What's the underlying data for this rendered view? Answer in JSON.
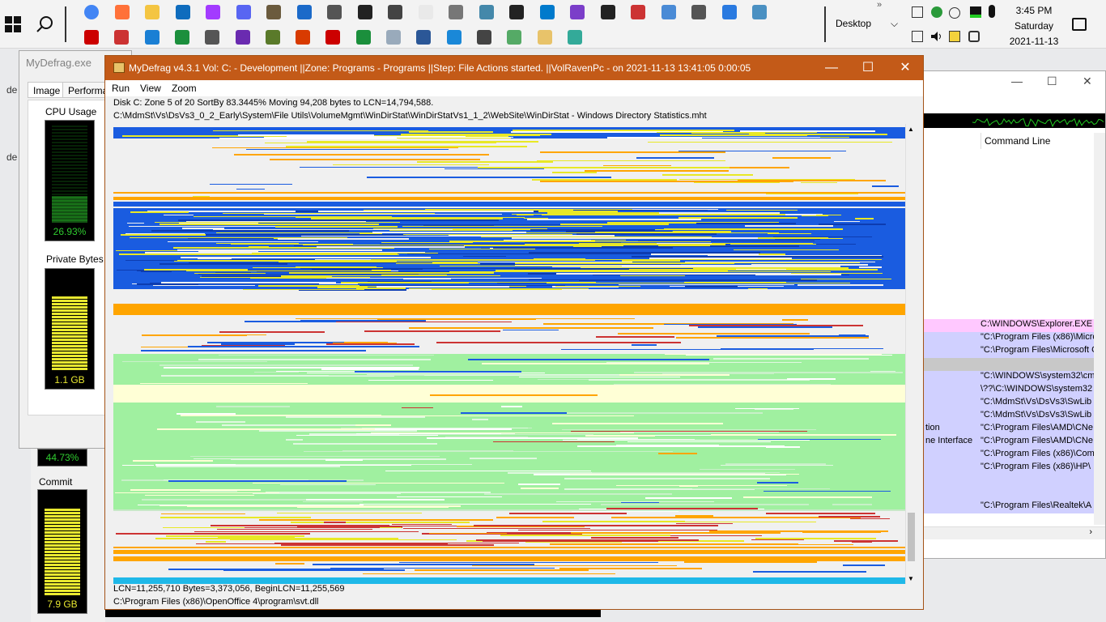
{
  "taskbar": {
    "desktop_label": "Desktop",
    "clock": {
      "time": "3:45 PM",
      "day": "Saturday",
      "date": "2021-11-13"
    },
    "pinned_icons": [
      "chrome-icon",
      "firefox-icon",
      "file-explorer-icon",
      "outlook-icon",
      "messenger-icon",
      "discord-icon",
      "gimp-icon",
      "photos-icon",
      "tool-icon",
      "cap-icon",
      "printer-icon",
      "notepad-icon",
      "checker-icon",
      "plugin-icon",
      "terminal-icon",
      "vscode-icon",
      "visual-studio-icon",
      "cmd-icon",
      "xmind-icon",
      "app-icon",
      "settings-icon",
      "remote-icon",
      "monitor-icon"
    ],
    "pinned_icons_row2": [
      "acrobat-icon",
      "pdf-icon",
      "todo-icon",
      "excel-icon",
      "screen-icon",
      "video-icon",
      "palm-icon",
      "office-icon",
      "acrobat-reader-icon",
      "spreadsheet-icon",
      "notes-icon",
      "word-icon",
      "browser-icon",
      "tool2-icon",
      "document-icon",
      "mydefrag-icon",
      "plugin2-icon"
    ]
  },
  "process_explorer": {
    "title": "MyDefrag.exe",
    "tabs": [
      "Image",
      "Performan"
    ],
    "cpu": {
      "label": "CPU Usage",
      "value": "26.93%",
      "fill": 0.27
    },
    "private_bytes": {
      "label": "Private Bytes",
      "value": "1.1 GB",
      "fill": 0.75
    },
    "io_value": "44.73%",
    "commit": {
      "label": "Commit",
      "value": "7.9 GB",
      "fill": 0.85
    }
  },
  "process_list": {
    "column_header": "Command Line",
    "left_fragments": [
      "tion",
      "ne Interface"
    ],
    "rows": [
      "C:\\WINDOWS\\Explorer.EXE",
      "\"C:\\Program Files (x86)\\Micro",
      "\"C:\\Program Files\\Microsoft O",
      "",
      "\"C:\\WINDOWS\\system32\\cm",
      "\\??\\C:\\WINDOWS\\system32",
      "\"C:\\MdmSt\\Vs\\DsVs3\\SwLib",
      "\"C:\\MdmSt\\Vs\\DsVs3\\SwLib",
      "\"C:\\Program Files\\AMD\\CNe",
      "\"C:\\Program Files\\AMD\\CNe",
      "\"C:\\Program Files (x86)\\Comm",
      "\"C:\\Program Files (x86)\\HP\\",
      "",
      "",
      "\"C:\\Program Files\\Realtek\\A"
    ]
  },
  "mydefrag": {
    "title": "MyDefrag v4.3.1   Vol: C: - Development ||Zone: Programs - Programs ||Step: File Actions started. ||VolRavenPc -  on 2021-11-13 13:41:05 0:00:05",
    "menu": [
      "Run",
      "View",
      "Zoom"
    ],
    "status_top": "Disk C:    Zone 5 of 20    SortBy    83.3445%    Moving 94,208 bytes to LCN=14,794,588.",
    "current_path": "C:\\MdmSt\\Vs\\DsVs3_0_2_Early\\System\\File Utils\\VolumeMgmt\\WinDirStat\\WinDirStatVs1_1_2\\WebSite\\WinDirStat - Windows Directory Statistics.mht",
    "status_bottom": "LCN=11,255,710     Bytes=3,373,056, BeginLCN=11,255,569",
    "bottom_path": "C:\\Program Files (x86)\\OpenOffice 4\\program\\svt.dll",
    "colors": {
      "titlebar": "#c35a18",
      "blue": "#1a5ce0",
      "yellow": "#e8e826",
      "orange": "#ffa500",
      "green": "#a0f0a0",
      "lightyellow": "#ffffd6",
      "cyan": "#1fb8e8",
      "free": "#f0f0f0"
    }
  }
}
